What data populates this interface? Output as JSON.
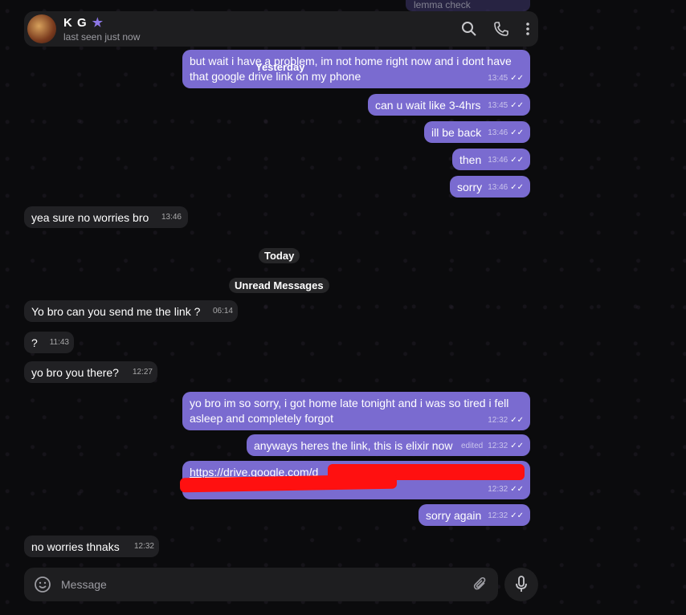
{
  "header": {
    "name": "K G",
    "status": "last seen just now",
    "star_icon": "star-icon"
  },
  "ghost_message": "lemma check",
  "date_pills": {
    "yesterday": "Yesterday",
    "today": "Today",
    "unread": "Unread Messages"
  },
  "messages": {
    "m1": {
      "text": "but wait i have a problem, im not home right now and i dont have that google drive link on my phone",
      "time": "13:45"
    },
    "m2": {
      "text": "can u wait like 3-4hrs",
      "time": "13:45"
    },
    "m3": {
      "text": "ill be back",
      "time": "13:46"
    },
    "m4": {
      "text": "then",
      "time": "13:46"
    },
    "m5": {
      "text": "sorry",
      "time": "13:46"
    },
    "m6": {
      "text": "yea sure no worries bro",
      "time": "13:46"
    },
    "m7": {
      "text": "Yo bro can you send me the link ?",
      "time": "06:14"
    },
    "m8": {
      "text": "?",
      "time": "11:43"
    },
    "m9": {
      "text": "yo bro you there?",
      "time": "12:27"
    },
    "m10": {
      "text": "yo bro im so sorry, i got home late tonight and i was so tired i fell asleep and completely forgot",
      "time": "12:32"
    },
    "m11": {
      "text": "anyways heres the link, this is elixir now",
      "edited": "edited",
      "time": "12:32"
    },
    "m12": {
      "text": "https://drive.google.com/d",
      "time": "12:32"
    },
    "m13": {
      "text": "sorry again",
      "time": "12:32"
    },
    "m14": {
      "text": "no worries thnaks",
      "time": "12:32"
    }
  },
  "composer": {
    "placeholder": "Message"
  },
  "colors": {
    "outgoing": "#7a6bd0",
    "incoming": "#212124",
    "accent": "#8c76e4",
    "redaction": "#ff1010"
  }
}
